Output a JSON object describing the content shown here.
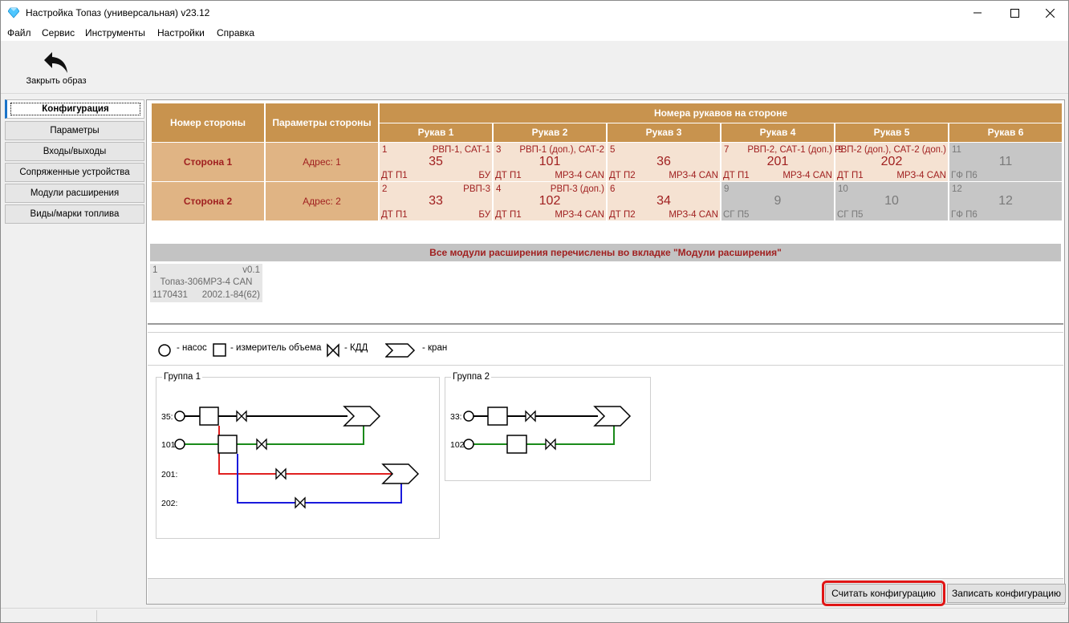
{
  "window": {
    "title": "Настройка Топаз (универсальная) v23.12"
  },
  "menu": [
    "Файл",
    "Сервис",
    "Инструменты",
    "Настройки",
    "Справка"
  ],
  "toolbar": {
    "close_image": "Закрыть образ"
  },
  "nav": [
    "Конфигурация",
    "Параметры",
    "Входы/выходы",
    "Сопряженные устройства",
    "Модули расширения",
    "Виды/марки топлива"
  ],
  "config": {
    "header_side": "Номер стороны",
    "header_params": "Параметры стороны",
    "header_hoses": "Номера рукавов на стороне",
    "hose_headers": [
      "Рукав 1",
      "Рукав 2",
      "Рукав 3",
      "Рукав 4",
      "Рукав 5",
      "Рукав 6"
    ],
    "sides": [
      {
        "name": "Сторона 1",
        "address": "Адрес: 1",
        "hoses": [
          {
            "n": "1",
            "fn": "РВП-1, САТ-1",
            "big": "35",
            "dt": "ДТ П1",
            "dev": "БУ",
            "off": false
          },
          {
            "n": "3",
            "fn": "РВП-1 (доп.), САТ-2",
            "big": "101",
            "dt": "ДТ П1",
            "dev": "МРЗ-4 CAN",
            "off": false
          },
          {
            "n": "5",
            "fn": "",
            "big": "36",
            "dt": "ДТ П2",
            "dev": "МРЗ-4 CAN",
            "off": false
          },
          {
            "n": "7",
            "fn": "РВП-2, САТ-1 (доп.)",
            "big": "201",
            "dt": "ДТ П1",
            "dev": "МРЗ-4 CAN",
            "off": false
          },
          {
            "n": "9",
            "fn": "РВП-2 (доп.), САТ-2 (доп.)",
            "big": "202",
            "dt": "ДТ П1",
            "dev": "МРЗ-4 CAN",
            "off": false
          },
          {
            "n": "11",
            "fn": "",
            "big": "11",
            "dt": "ГФ П6",
            "dev": "",
            "off": true
          }
        ]
      },
      {
        "name": "Сторона 2",
        "address": "Адрес: 2",
        "hoses": [
          {
            "n": "2",
            "fn": "РВП-3",
            "big": "33",
            "dt": "ДТ П1",
            "dev": "БУ",
            "off": false
          },
          {
            "n": "4",
            "fn": "РВП-3 (доп.)",
            "big": "102",
            "dt": "ДТ П1",
            "dev": "МРЗ-4 CAN",
            "off": false
          },
          {
            "n": "6",
            "fn": "",
            "big": "34",
            "dt": "ДТ П2",
            "dev": "МРЗ-4 CAN",
            "off": false
          },
          {
            "n": "9",
            "fn": "",
            "big": "9",
            "dt": "СГ П5",
            "dev": "",
            "off": true
          },
          {
            "n": "10",
            "fn": "",
            "big": "10",
            "dt": "СГ П5",
            "dev": "",
            "off": true
          },
          {
            "n": "12",
            "fn": "",
            "big": "12",
            "dt": "ГФ П6",
            "dev": "",
            "off": true
          }
        ]
      }
    ],
    "modules_bar": "Все модули расширения перечислены во вкладке \"Модули расширения\"",
    "module": {
      "num": "1",
      "ver": "v0.1",
      "name": "Топаз-306МРЗ-4 CAN",
      "serial": "1170431",
      "code": "2002.1-84(62)"
    }
  },
  "legend": {
    "pump": "- насос",
    "meter": "- измеритель объема",
    "kdd": "- КДД",
    "nozzle": "- кран"
  },
  "groups": [
    {
      "title": "Группа 1",
      "labels": [
        "35:",
        "101:",
        "201:",
        "202:"
      ]
    },
    {
      "title": "Группа 2",
      "labels": [
        "33:",
        "102:"
      ]
    }
  ],
  "buttons": {
    "read": "Считать конфигурацию",
    "write": "Записать конфигурацию"
  },
  "colors": {
    "header": "#c8934e",
    "side": "#e0b484",
    "hose": "#f5e2d2",
    "disabled": "#c6c6c6",
    "text_red": "#a02020",
    "line_red": "#e02020",
    "line_green": "#1a8a1a",
    "line_blue": "#1a1adc",
    "highlight": "#e01515"
  }
}
